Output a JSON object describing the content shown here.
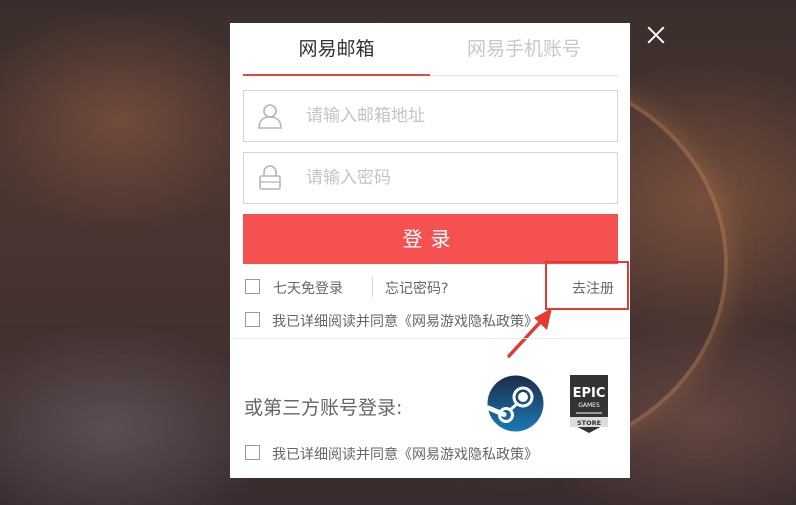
{
  "tabs": [
    {
      "label": "网易邮箱",
      "active": true
    },
    {
      "label": "网易手机账号",
      "active": false
    }
  ],
  "email_field": {
    "placeholder": "请输入邮箱地址",
    "icon": "user-icon"
  },
  "password_field": {
    "placeholder": "请输入密码",
    "icon": "lock-icon"
  },
  "login_button": {
    "label": "登录"
  },
  "remember": {
    "label": "七天免登录",
    "checked": false
  },
  "forgot_password": {
    "label": "忘记密码?"
  },
  "register": {
    "label": "去注册"
  },
  "privacy_top": {
    "label": "我已详细阅读并同意《网易游戏隐私政策》",
    "checked": false
  },
  "third_party": {
    "label": "或第三方账号登录:",
    "providers": [
      {
        "icon": "steam-icon"
      },
      {
        "icon": "epic-games-store-icon",
        "text_lines": [
          "EPIC",
          "GAMES",
          "STORE"
        ]
      }
    ]
  },
  "privacy_bottom": {
    "label": "我已详细阅读并同意《网易游戏隐私政策》",
    "checked": false
  },
  "colors": {
    "accent": "#f65151",
    "tab_underline": "#e8473e",
    "highlight": "#e53a2f"
  },
  "close_icon": "close-icon"
}
